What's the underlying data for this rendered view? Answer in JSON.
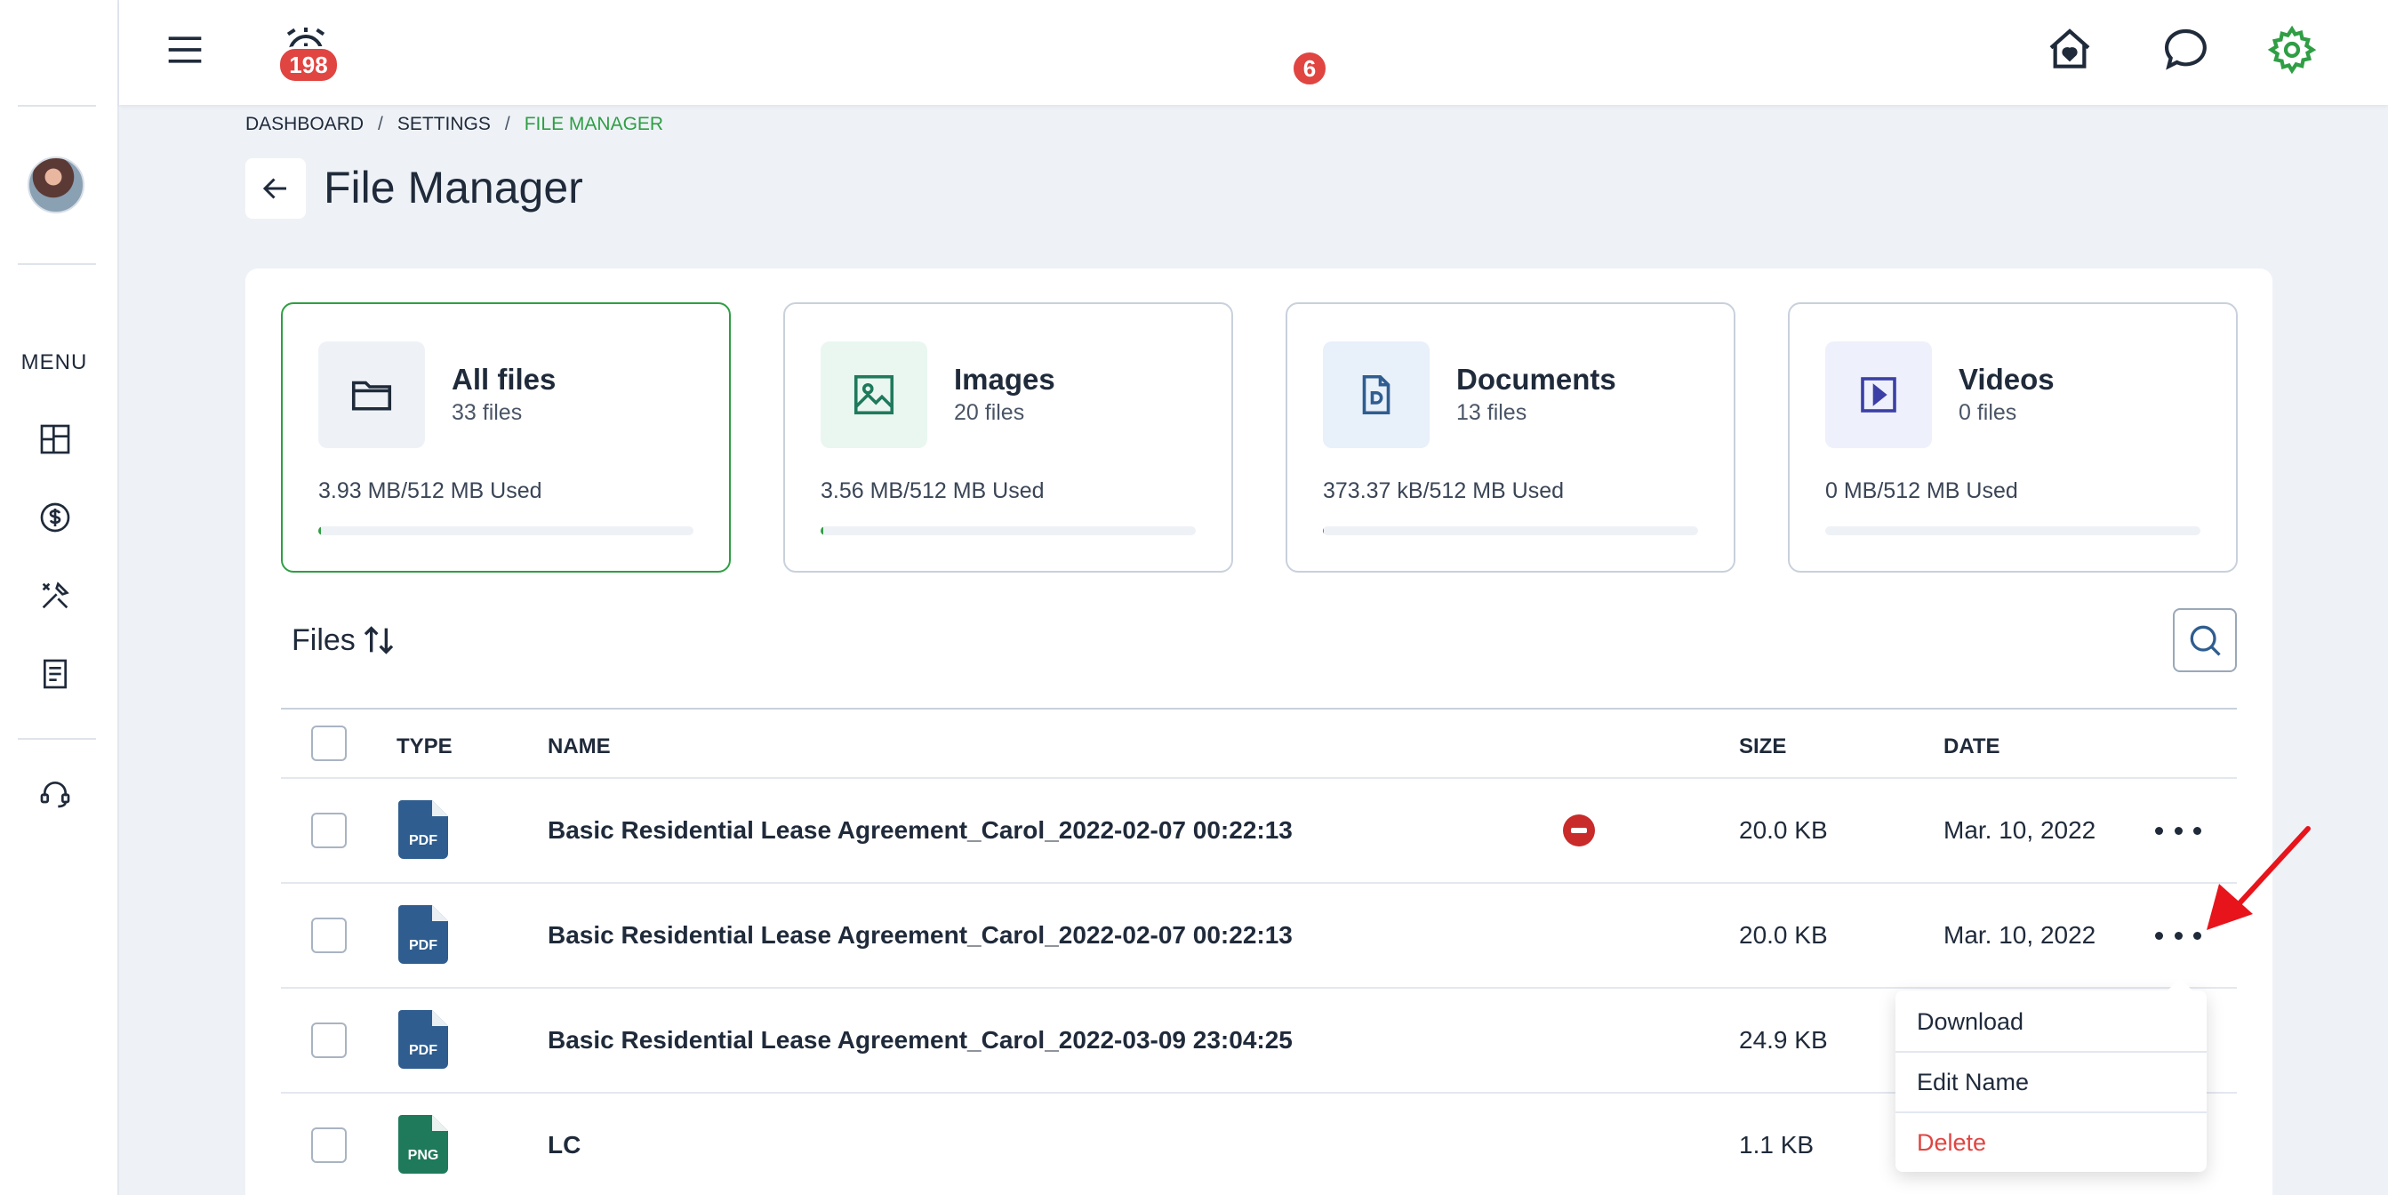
{
  "sidebar": {
    "menu_label": "MENU",
    "icons": [
      "dashboard-icon",
      "dollar-icon",
      "tools-icon",
      "document-icon",
      "headset-icon"
    ]
  },
  "topbar": {
    "alarm_count": "198",
    "messages_count": "6",
    "icons": [
      "hamburger-icon",
      "alarm-clock-icon",
      "home-heart-icon",
      "chat-bubble-icon",
      "gear-icon"
    ]
  },
  "breadcrumb": {
    "items": [
      "DASHBOARD",
      "SETTINGS",
      "FILE MANAGER"
    ],
    "separator": "/"
  },
  "page": {
    "title": "File Manager"
  },
  "cards": [
    {
      "title": "All files",
      "count": "33 files",
      "used": "3.93 MB/512 MB Used",
      "icon": "folder-icon",
      "fraction": 0.0077
    },
    {
      "title": "Images",
      "count": "20 files",
      "used": "3.56 MB/512 MB Used",
      "icon": "image-icon",
      "fraction": 0.007
    },
    {
      "title": "Documents",
      "count": "13 files",
      "used": "373.37 kB/512 MB Used",
      "icon": "document-icon",
      "fraction": 0.0007
    },
    {
      "title": "Videos",
      "count": "0 files",
      "used": "0 MB/512 MB Used",
      "icon": "video-icon",
      "fraction": 0
    }
  ],
  "files": {
    "heading": "Files",
    "sort_icon": "sort-arrows-icon",
    "columns": {
      "type": "TYPE",
      "name": "NAME",
      "size": "SIZE",
      "date": "DATE"
    },
    "rows": [
      {
        "type": "PDF",
        "name": "Basic Residential Lease Agreement_Carol_2022-02-07 00:22:13",
        "size": "20.0 KB",
        "date": "Mar. 10, 2022"
      },
      {
        "type": "PDF",
        "name": "Basic Residential Lease Agreement_Carol_2022-02-07 00:22:13",
        "size": "20.0 KB",
        "date": "Mar. 10, 2022"
      },
      {
        "type": "PDF",
        "name": "Basic Residential Lease Agreement_Carol_2022-03-09 23:04:25",
        "size": "24.9 KB",
        "date": ""
      },
      {
        "type": "PNG",
        "name": "LC",
        "size": "1.1 KB",
        "date": ""
      }
    ]
  },
  "context_menu": {
    "download": "Download",
    "edit_name": "Edit Name",
    "delete": "Delete"
  },
  "colors": {
    "accent": "#2f9e44",
    "danger": "#e04541",
    "pdf": "#2f5d8f",
    "png": "#1f7a5c"
  }
}
